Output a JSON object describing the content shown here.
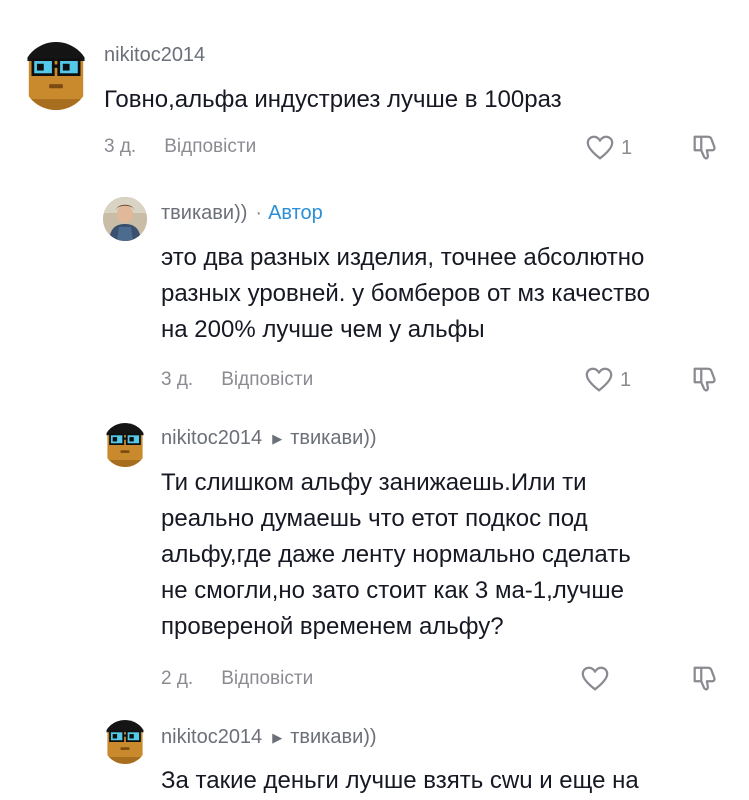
{
  "comments": [
    {
      "username": "nikitoc2014",
      "text": "Говно,альфа индустриез лучше в 100раз",
      "time": "3 д.",
      "reply_label": "Відповісти",
      "likes": "1"
    },
    {
      "username": "твикави))",
      "author_separator": "·",
      "author_tag": "Автор",
      "text_lines": [
        "это два разных изделия, точнее абсолютно",
        "разных уровней. у бомберов от мз качество",
        "на 200% лучше чем у альфы"
      ],
      "time": "3 д.",
      "reply_label": "Відповісти",
      "likes": "1"
    },
    {
      "username": "nikitoc2014",
      "reply_to": "твикави))",
      "text_lines": [
        "Ти слишком альфу занижаешь.Или ти",
        "реально думаешь что етот подкос под",
        "альфу,где даже ленту нормально сделать",
        "не смогли,но зато стоит как 3 ма-1,лучше",
        "провереной временем альфу?"
      ],
      "time": "2 д.",
      "reply_label": "Відповісти",
      "likes": ""
    },
    {
      "username": "nikitoc2014",
      "reply_to": "твикави))",
      "text_lines": [
        "За такие деньги лучше взять cwu и еще на"
      ]
    }
  ],
  "icons": {
    "like": "heart-outline-icon",
    "dislike": "thumbs-down-icon",
    "reply_arrow": "triangle-right-icon"
  },
  "colors": {
    "text": "#161823",
    "muted": "#8a8b91",
    "author_tag": "#2a8fd6"
  }
}
